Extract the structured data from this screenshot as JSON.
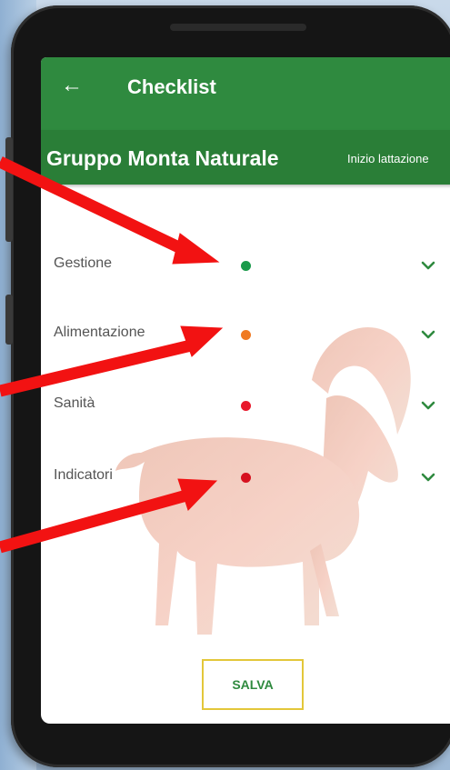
{
  "header": {
    "title": "Checklist",
    "back_icon": "arrow-left-icon"
  },
  "subheader": {
    "group_name": "Gruppo Monta Naturale",
    "phase": "Inizio lattazione"
  },
  "checklist": {
    "items": [
      {
        "label": "Gestione",
        "status_color": "#1a9a4a"
      },
      {
        "label": "Alimentazione",
        "status_color": "#f07a22"
      },
      {
        "label": "Sanità",
        "status_color": "#e8192c"
      },
      {
        "label": "Indicatori",
        "status_color": "#d6111f"
      }
    ],
    "expand_icon": "chevron-down-icon"
  },
  "actions": {
    "save_label": "SALVA"
  },
  "colors": {
    "primary": "#2f8a3f",
    "accent": "#e3c73a",
    "annotation": "#f21212"
  }
}
